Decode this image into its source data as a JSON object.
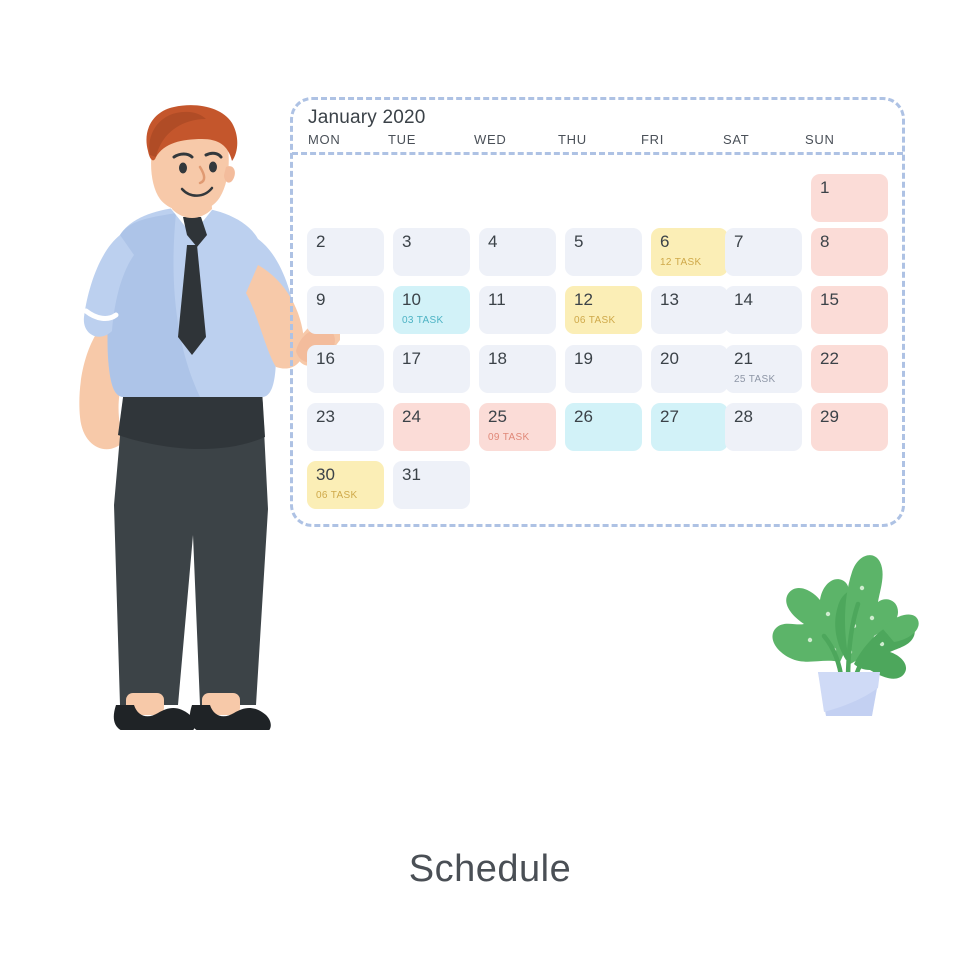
{
  "caption": "Schedule",
  "calendar": {
    "month_title": "January 2020",
    "day_headers": [
      "MON",
      "TUE",
      "WED",
      "THU",
      "FRI",
      "SAT",
      "SUN"
    ],
    "weeks": [
      [
        {
          "day": "",
          "task": "",
          "tone": "empty"
        },
        {
          "day": "",
          "task": "",
          "tone": "empty"
        },
        {
          "day": "",
          "task": "",
          "tone": "empty"
        },
        {
          "day": "",
          "task": "",
          "tone": "empty"
        },
        {
          "day": "",
          "task": "",
          "tone": "empty"
        },
        {
          "day": "",
          "task": "",
          "tone": "empty"
        },
        {
          "day": "1",
          "task": "",
          "tone": "pink"
        }
      ],
      [
        {
          "day": "2",
          "task": "",
          "tone": "default"
        },
        {
          "day": "3",
          "task": "",
          "tone": "default"
        },
        {
          "day": "4",
          "task": "",
          "tone": "default"
        },
        {
          "day": "5",
          "task": "",
          "tone": "default"
        },
        {
          "day": "6",
          "task": "12 TASK",
          "tone": "yellow"
        },
        {
          "day": "7",
          "task": "",
          "tone": "default"
        },
        {
          "day": "8",
          "task": "",
          "tone": "pink"
        }
      ],
      [
        {
          "day": "9",
          "task": "",
          "tone": "default"
        },
        {
          "day": "10",
          "task": "03 TASK",
          "tone": "cyan"
        },
        {
          "day": "11",
          "task": "",
          "tone": "default"
        },
        {
          "day": "12",
          "task": "06 TASK",
          "tone": "yellow"
        },
        {
          "day": "13",
          "task": "",
          "tone": "default"
        },
        {
          "day": "14",
          "task": "",
          "tone": "default"
        },
        {
          "day": "15",
          "task": "",
          "tone": "pink"
        }
      ],
      [
        {
          "day": "16",
          "task": "",
          "tone": "default"
        },
        {
          "day": "17",
          "task": "",
          "tone": "default"
        },
        {
          "day": "18",
          "task": "",
          "tone": "default"
        },
        {
          "day": "19",
          "task": "",
          "tone": "default"
        },
        {
          "day": "20",
          "task": "",
          "tone": "default"
        },
        {
          "day": "21",
          "task": "25 TASK",
          "tone": "default"
        },
        {
          "day": "22",
          "task": "",
          "tone": "pink"
        }
      ],
      [
        {
          "day": "23",
          "task": "",
          "tone": "default"
        },
        {
          "day": "24",
          "task": "",
          "tone": "pink"
        },
        {
          "day": "25",
          "task": "09 TASK",
          "tone": "pink"
        },
        {
          "day": "26",
          "task": "",
          "tone": "cyan"
        },
        {
          "day": "27",
          "task": "",
          "tone": "cyan"
        },
        {
          "day": "28",
          "task": "",
          "tone": "default"
        },
        {
          "day": "29",
          "task": "",
          "tone": "pink"
        }
      ],
      [
        {
          "day": "30",
          "task": "06 TASK",
          "tone": "yellow"
        },
        {
          "day": "31",
          "task": "",
          "tone": "default"
        },
        {
          "day": "",
          "task": "",
          "tone": "empty"
        },
        {
          "day": "",
          "task": "",
          "tone": "empty"
        },
        {
          "day": "",
          "task": "",
          "tone": "empty"
        },
        {
          "day": "",
          "task": "",
          "tone": "empty"
        },
        {
          "day": "",
          "task": "",
          "tone": "empty"
        }
      ]
    ]
  },
  "illustration": {
    "character_name": "businessman-pointing",
    "plant_name": "potted-plant"
  },
  "colors": {
    "cell_default": "#eef1f8",
    "cell_yellow": "#fbeeb6",
    "cell_cyan": "#d2f2f8",
    "cell_pink": "#fbdcd7",
    "dashed_border": "#aec2e4",
    "text_dark": "#3b4248",
    "background": "#ffffff",
    "skin": "#f7c9a9",
    "hair": "#c4562c",
    "shirt": "#bcd0ef",
    "tie": "#2f3438",
    "trousers": "#3c4347",
    "shoes": "#1f2326",
    "leaf": "#5cb469",
    "pot": "#b9c8ef"
  }
}
